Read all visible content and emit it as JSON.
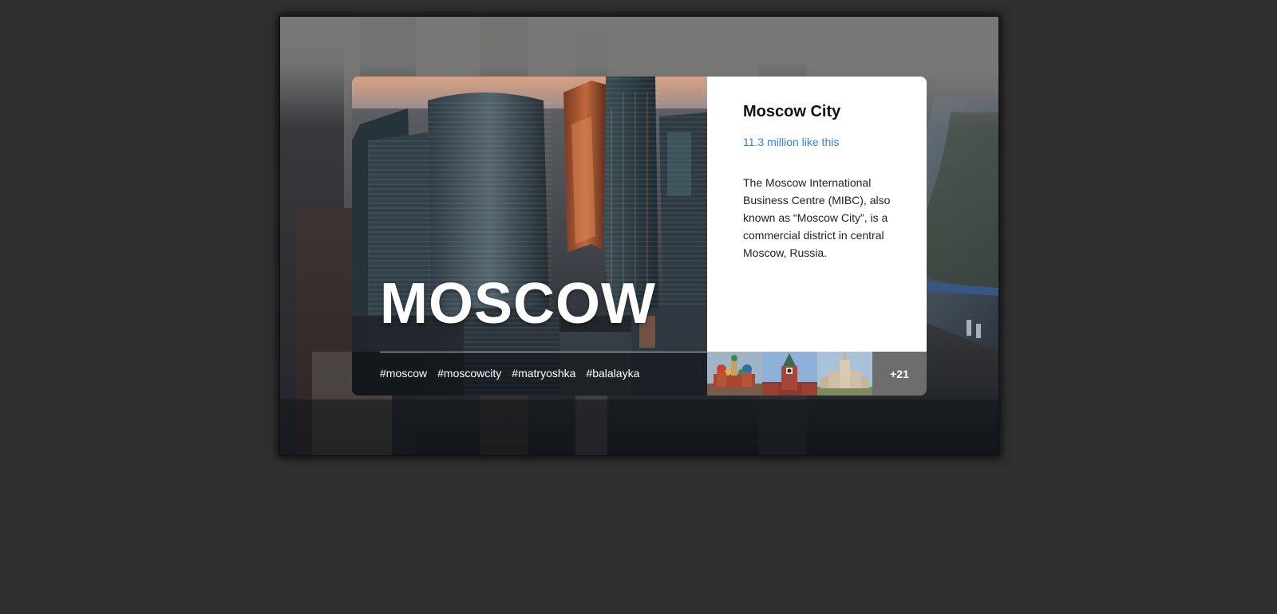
{
  "card": {
    "title": "MOSCOW",
    "tags": [
      "#moscow",
      "#moscowcity",
      "#matryoshka",
      "#balalayka"
    ]
  },
  "info": {
    "title": "Moscow City",
    "likes": "11.3 million like this",
    "description": "The Moscow International Business Centre (MIBC), also known as “Moscow City”, is a commercial district in central Moscow, Russia."
  },
  "gallery": {
    "thumbnails": [
      "st-basils-cathedral-thumbnail",
      "kremlin-spasskaya-tower-thumbnail",
      "moscow-state-university-thumbnail"
    ],
    "more_label": "+21"
  },
  "colors": {
    "page_background": "#303030",
    "accent_link": "#3b7fd6",
    "more_badge": "#6d6d6d"
  }
}
